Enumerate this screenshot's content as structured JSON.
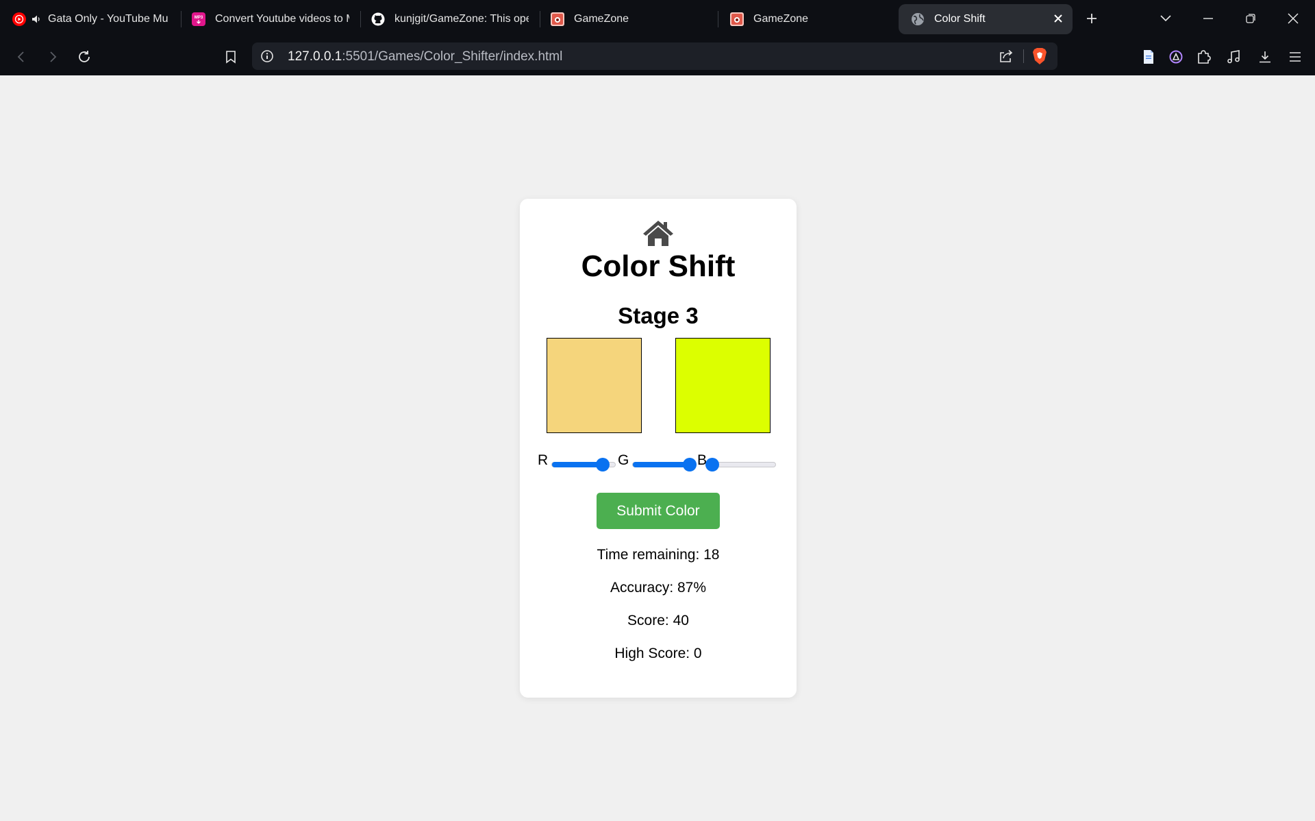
{
  "browser": {
    "tabs": [
      {
        "title": "Gata Only - YouTube Mu",
        "icon": "youtube-music-icon"
      },
      {
        "title": "Convert Youtube videos to M",
        "icon": "mp3-converter-icon"
      },
      {
        "title": "kunjgit/GameZone: This ope",
        "icon": "github-icon"
      },
      {
        "title": "GameZone",
        "icon": "gamezone-icon"
      },
      {
        "title": "GameZone",
        "icon": "gamezone-icon"
      },
      {
        "title": "Color Shift",
        "icon": "globe-icon",
        "active": true
      }
    ],
    "url_host": "127.0.0.1",
    "url_rest": ":5501/Games/Color_Shifter/index.html"
  },
  "game": {
    "title": "Color Shift",
    "stage": "Stage 3",
    "target_color": "#f5d57c",
    "user_color": "#dcff00",
    "sliders": [
      {
        "label": "R",
        "value": 0.8
      },
      {
        "label": "G",
        "value": 0.9
      },
      {
        "label": "B",
        "value": 0.0
      }
    ],
    "submit_label": "Submit Color",
    "time_remaining": "Time remaining: 18",
    "accuracy": "Accuracy: 87%",
    "score": "Score: 40",
    "high_score": "High Score: 0",
    "accent_color": "#0a72f0",
    "button_color": "#4caf50"
  }
}
